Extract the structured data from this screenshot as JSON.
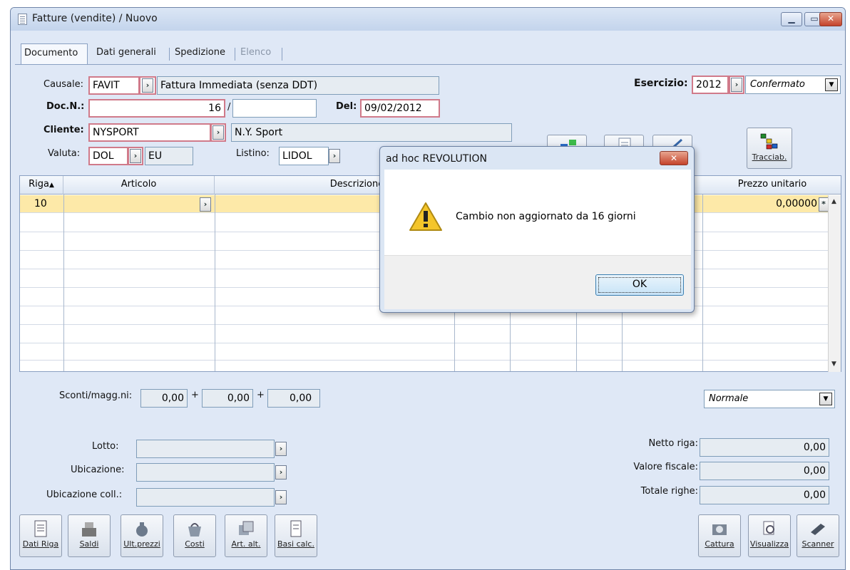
{
  "window": {
    "title": "Fatture (vendite) / Nuovo",
    "min": "▭",
    "max": "▭",
    "close": "✕"
  },
  "tabs": [
    {
      "label": "Documento"
    },
    {
      "label": "Dati generali"
    },
    {
      "label": "Spedizione"
    },
    {
      "label": "Elenco"
    }
  ],
  "header": {
    "causale_label": "Causale:",
    "causale_code": "FAVIT",
    "causale_desc": "Fattura Immediata (senza DDT)",
    "esercizio_label": "Esercizio:",
    "esercizio_value": "2012",
    "stato_value": "Confermato",
    "docn_label": "Doc.N.:",
    "docn_value": "16",
    "docn_sep": "/",
    "docn_serie": "",
    "del_label": "Del:",
    "del_value": "09/02/2012",
    "cliente_label": "Cliente:",
    "cliente_code": "NYSPORT",
    "cliente_desc": "N.Y. Sport",
    "valuta_label": "Valuta:",
    "valuta_code": "DOL",
    "valuta_desc": "EU",
    "listino_label": "Listino:",
    "listino_code": "LIDOL",
    "tracciab_label": "Tracciab."
  },
  "grid": {
    "columns": [
      "Riga",
      "Articolo",
      "Descrizione",
      "Prezzo unitario"
    ],
    "rows": [
      {
        "riga": "10",
        "articolo": "",
        "descrizione": "",
        "prezzo": "0,00000"
      }
    ]
  },
  "footer": {
    "sconti_label": "Sconti/magg.ni:",
    "sconto1": "0,00",
    "sconto2": "0,00",
    "sconto3": "0,00",
    "plus": "+",
    "tipo_riga": "Normale",
    "lotto_label": "Lotto:",
    "ubicazione_label": "Ubicazione:",
    "ubicazione_coll_label": "Ubicazione coll.:",
    "netto_riga_label": "Netto riga:",
    "netto_riga": "0,00",
    "valore_fiscale_label": "Valore fiscale:",
    "valore_fiscale": "0,00",
    "totale_righe_label": "Totale righe:",
    "totale_righe": "0,00"
  },
  "bottom_buttons": [
    {
      "label": "Dati Riga",
      "icon": "document-lines-icon"
    },
    {
      "label": "Saldi",
      "icon": "cash-register-icon"
    },
    {
      "label": "Ult.prezzi",
      "icon": "money-bag-icon"
    },
    {
      "label": "Costi",
      "icon": "basket-icon"
    },
    {
      "label": "Art. alt.",
      "icon": "articles-icon"
    },
    {
      "label": "Basi calc.",
      "icon": "calc-doc-icon"
    },
    {
      "label": "Cattura",
      "icon": "camera-icon"
    },
    {
      "label": "Visualizza",
      "icon": "view-icon"
    },
    {
      "label": "Scanner",
      "icon": "scanner-icon"
    }
  ],
  "dialog": {
    "title": "ad hoc REVOLUTION",
    "message": "Cambio non aggiornato da 16 giorni",
    "ok": "OK",
    "close": "✕"
  },
  "colors": {
    "required_border": "#d07a8a",
    "selected_row": "#fde9a8",
    "window_bg": "#dfe8f6"
  }
}
